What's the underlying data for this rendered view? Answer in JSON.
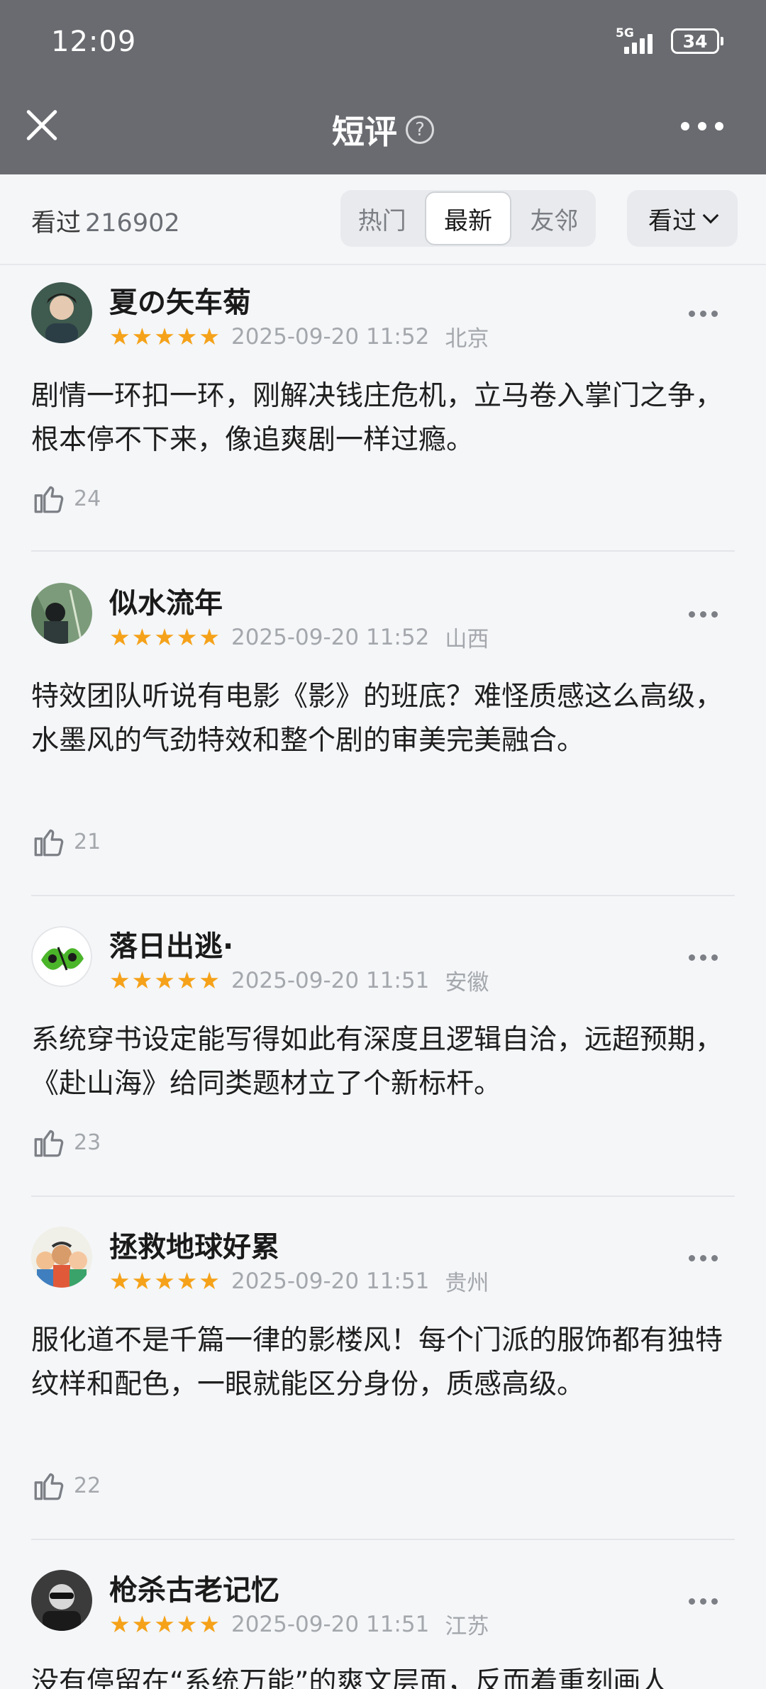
{
  "status_bar": {
    "time": "12:09",
    "network": "5G",
    "battery": "34"
  },
  "header": {
    "title": "短评",
    "help_icon": "?"
  },
  "filter": {
    "seen_label": "看过",
    "seen_count": "216902",
    "tabs": [
      {
        "label": "热门",
        "active": false
      },
      {
        "label": "最新",
        "active": true
      },
      {
        "label": "友邻",
        "active": false
      }
    ],
    "dropdown_label": "看过"
  },
  "reviews": [
    {
      "user": "夏の矢车菊",
      "rating": 5,
      "datetime": "2025-09-20 11:52",
      "location": "北京",
      "text": "剧情一环扣一环，刚解决钱庄危机，立马卷入掌门之争，根本停不下来，像追爽剧一样过瘾。",
      "likes": "24"
    },
    {
      "user": "似水流年",
      "rating": 5,
      "datetime": "2025-09-20 11:52",
      "location": "山西",
      "text": "特效团队听说有电影《影》的班底？难怪质感这么高级，水墨风的气劲特效和整个剧的审美完美融合。",
      "likes": "21"
    },
    {
      "user": "落日出逃·",
      "rating": 5,
      "datetime": "2025-09-20 11:51",
      "location": "安徽",
      "text": "系统穿书设定能写得如此有深度且逻辑自洽，远超预期，《赴山海》给同类题材立了个新标杆。",
      "likes": "23"
    },
    {
      "user": "拯救地球好累",
      "rating": 5,
      "datetime": "2025-09-20 11:51",
      "location": "贵州",
      "text": "服化道不是千篇一律的影楼风！每个门派的服饰都有独特纹样和配色，一眼就能区分身份，质感高级。",
      "likes": "22"
    },
    {
      "user": "枪杀古老记忆",
      "rating": 5,
      "datetime": "2025-09-20 11:51",
      "location": "江苏",
      "text": "没有停留在“系统万能”的爽文层面，反而着重刻画人",
      "likes": ""
    }
  ],
  "colors": {
    "header_bg": "#696b70",
    "star": "#f5a21a",
    "page_bg": "#f4f6f8"
  }
}
